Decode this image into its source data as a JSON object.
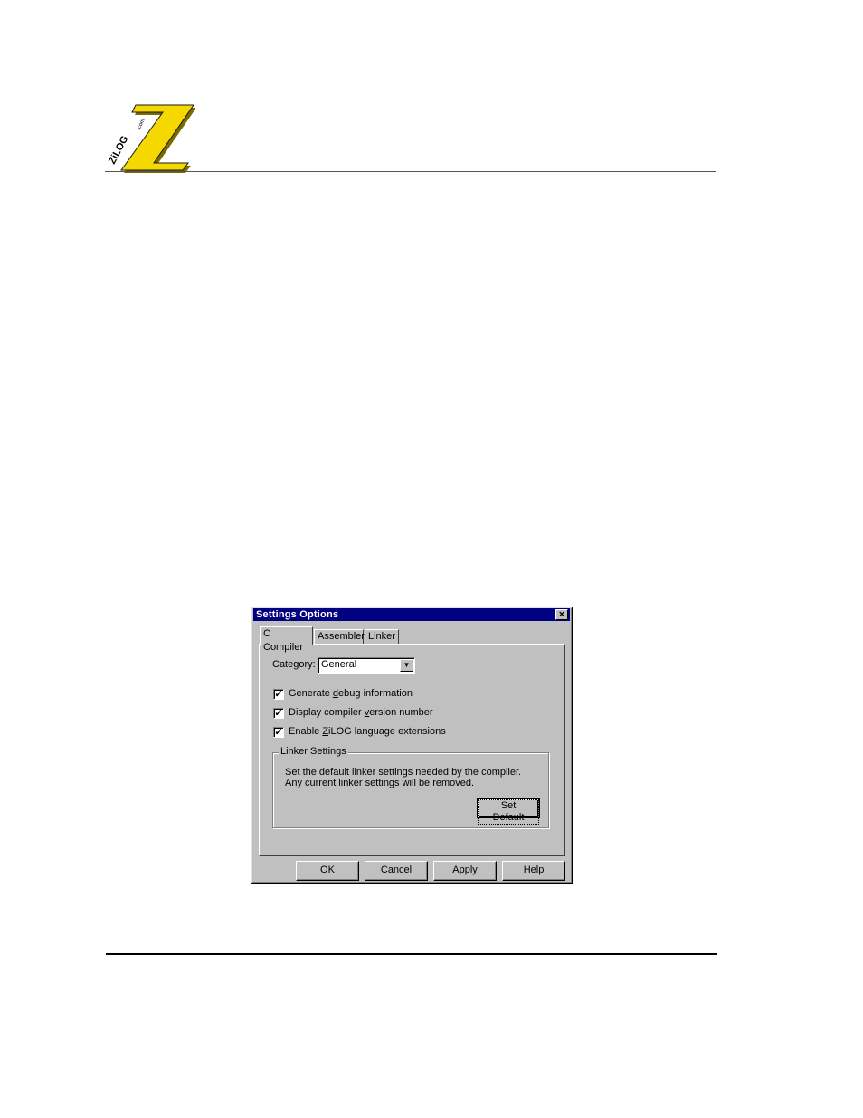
{
  "header": {
    "logo": {
      "letter": "Z",
      "wordmark": "ZiLOG",
      "suffix": ".com",
      "colors": {
        "fill": "#f5d800",
        "outline": "#000000",
        "shadow": "#8a7a00"
      }
    }
  },
  "dialog": {
    "title": "Settings Options",
    "close_icon": "×",
    "tabs": [
      {
        "label": "C Compiler",
        "active": true
      },
      {
        "label": "Assembler",
        "active": false
      },
      {
        "label": "Linker",
        "active": false
      }
    ],
    "category": {
      "label": "Category:",
      "value": "General",
      "arrow_icon": "▼"
    },
    "checkboxes": [
      {
        "pre": "Generate ",
        "ul": "d",
        "post": "ebug information",
        "checked": true
      },
      {
        "pre": "Display compiler ",
        "ul": "v",
        "post": "ersion number",
        "checked": true
      },
      {
        "pre": "Enable ",
        "ul": "Z",
        "post": "iLOG language extensions",
        "checked": true
      }
    ],
    "check_mark": "✓",
    "linker_settings": {
      "legend": "Linker Settings",
      "description": "Set the default linker settings needed by the compiler. Any current linker settings will be removed.",
      "button": "Set Default"
    },
    "buttons": {
      "ok": "OK",
      "cancel": "Cancel",
      "apply": {
        "ul": "A",
        "rest": "pply"
      },
      "help": "Help"
    },
    "colors": {
      "face": "#c0c0c0",
      "title_bar": "#000080"
    }
  }
}
